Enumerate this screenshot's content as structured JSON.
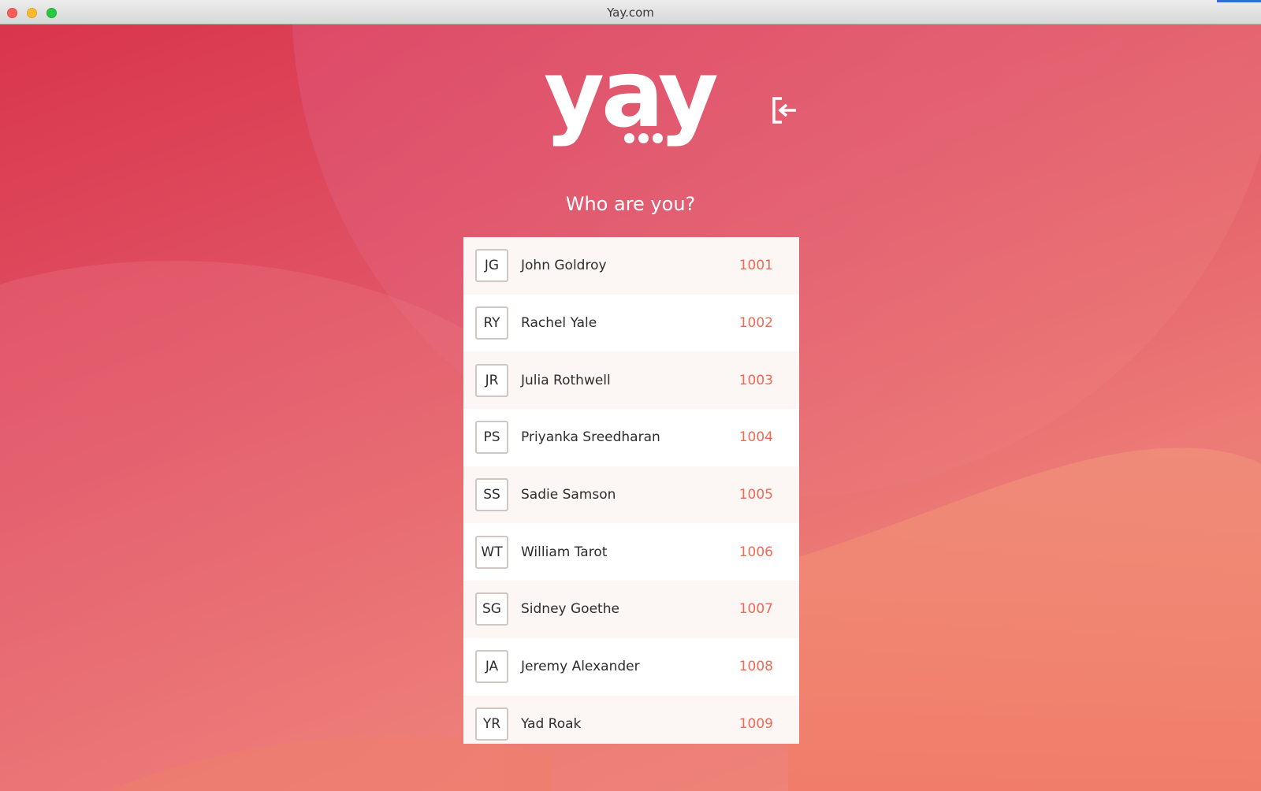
{
  "window": {
    "title": "Yay.com"
  },
  "logo": {
    "text": "yay"
  },
  "header": {
    "logout_icon": "logout-icon"
  },
  "heading": "Who are you?",
  "users": [
    {
      "initials": "JG",
      "name": "John Goldroy",
      "id": "1001"
    },
    {
      "initials": "RY",
      "name": "Rachel Yale",
      "id": "1002"
    },
    {
      "initials": "JR",
      "name": "Julia Rothwell",
      "id": "1003"
    },
    {
      "initials": "PS",
      "name": "Priyanka Sreedharan",
      "id": "1004"
    },
    {
      "initials": "SS",
      "name": "Sadie Samson",
      "id": "1005"
    },
    {
      "initials": "WT",
      "name": "William Tarot",
      "id": "1006"
    },
    {
      "initials": "SG",
      "name": "Sidney Goethe",
      "id": "1007"
    },
    {
      "initials": "JA",
      "name": "Jeremy Alexander",
      "id": "1008"
    },
    {
      "initials": "YR",
      "name": "Yad Roak",
      "id": "1009"
    }
  ],
  "colors": {
    "accent": "#ef6a55",
    "background_top": "#d9354c",
    "background_bottom": "#f08a78"
  }
}
